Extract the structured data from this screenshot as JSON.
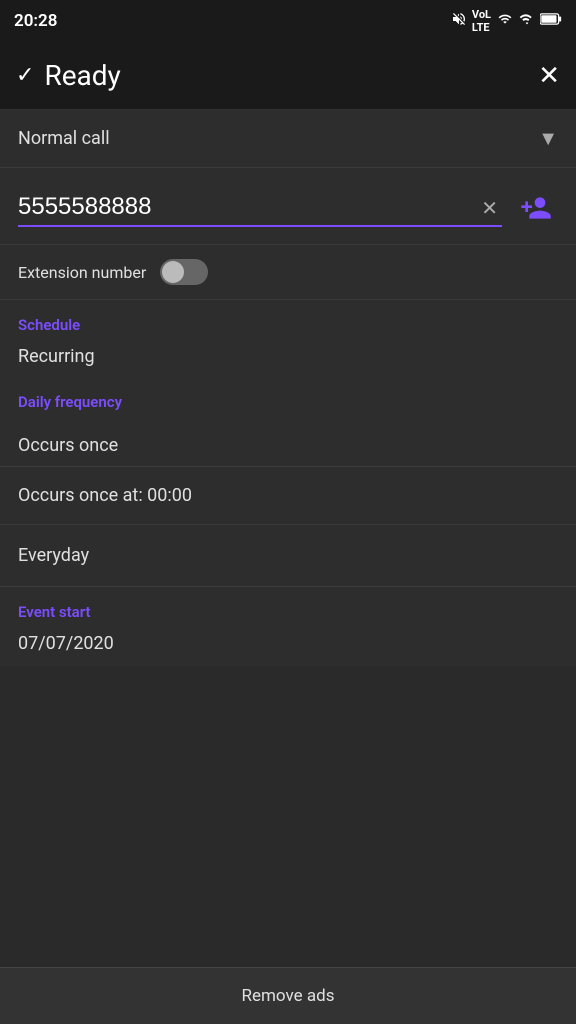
{
  "statusBar": {
    "time": "20:28"
  },
  "topBar": {
    "checkSymbol": "✓",
    "title": "Ready",
    "closeSymbol": "✕"
  },
  "callType": {
    "label": "Normal call",
    "arrowSymbol": "▼"
  },
  "phoneInput": {
    "value": "5555588888",
    "clearSymbol": "✕",
    "addContactSymbol": "👤+"
  },
  "extension": {
    "label": "Extension number",
    "enabled": false
  },
  "schedule": {
    "sectionTitle": "Schedule",
    "value": "Recurring"
  },
  "dailyFrequency": {
    "sectionTitle": "Daily frequency",
    "value": "Occurs once"
  },
  "occursOnceAt": {
    "label": "Occurs once at: 00:00"
  },
  "everyday": {
    "label": "Everyday"
  },
  "eventStart": {
    "sectionTitle": "Event start",
    "date": "07/07/2020"
  },
  "removeAds": {
    "label": "Remove ads"
  },
  "icons": {
    "mute": "🔇",
    "lte": "LTE",
    "wifi": "📶",
    "signal": "📶",
    "battery": "🔋"
  }
}
